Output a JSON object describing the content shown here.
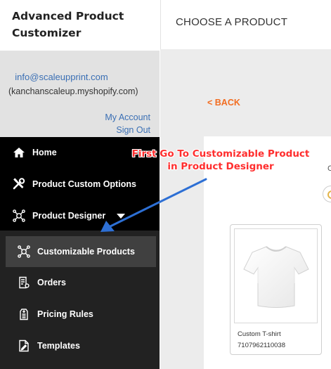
{
  "app": {
    "title": "Advanced Product Customizer"
  },
  "account": {
    "email": "info@scaleupprint.com",
    "shop": "(kanchanscaleup.myshopify.com)",
    "my_account": "My Account",
    "sign_out": "Sign Out"
  },
  "nav": {
    "items": [
      {
        "label": "Home",
        "icon": "home-icon"
      },
      {
        "label": "Product Custom Options",
        "icon": "tools-icon"
      },
      {
        "label": "Product Designer",
        "icon": "network-icon"
      }
    ],
    "submenu": [
      {
        "label": "Customizable Products",
        "icon": "network-icon",
        "active": true
      },
      {
        "label": "Orders",
        "icon": "orders-icon"
      },
      {
        "label": "Pricing Rules",
        "icon": "price-tag-icon"
      },
      {
        "label": "Templates",
        "icon": "template-icon"
      }
    ]
  },
  "main": {
    "title": "CHOOSE A PRODUCT",
    "back_label": "< BACK",
    "partial_text": "C"
  },
  "product": {
    "name": "Custom T-shirt",
    "id": "7107962110038",
    "image": "white-tshirt"
  },
  "annotation": {
    "line1": "First Go To Customizable Product",
    "line2": "in Product Designer",
    "color": "#ff2e2e",
    "arrow_color": "#2d6fd4"
  },
  "colors": {
    "sidebar_bg": "#000000",
    "submenu_bg": "#222222",
    "active_item_bg": "#404040",
    "link_blue": "#3a6fb4",
    "back_orange": "#f26d21"
  }
}
